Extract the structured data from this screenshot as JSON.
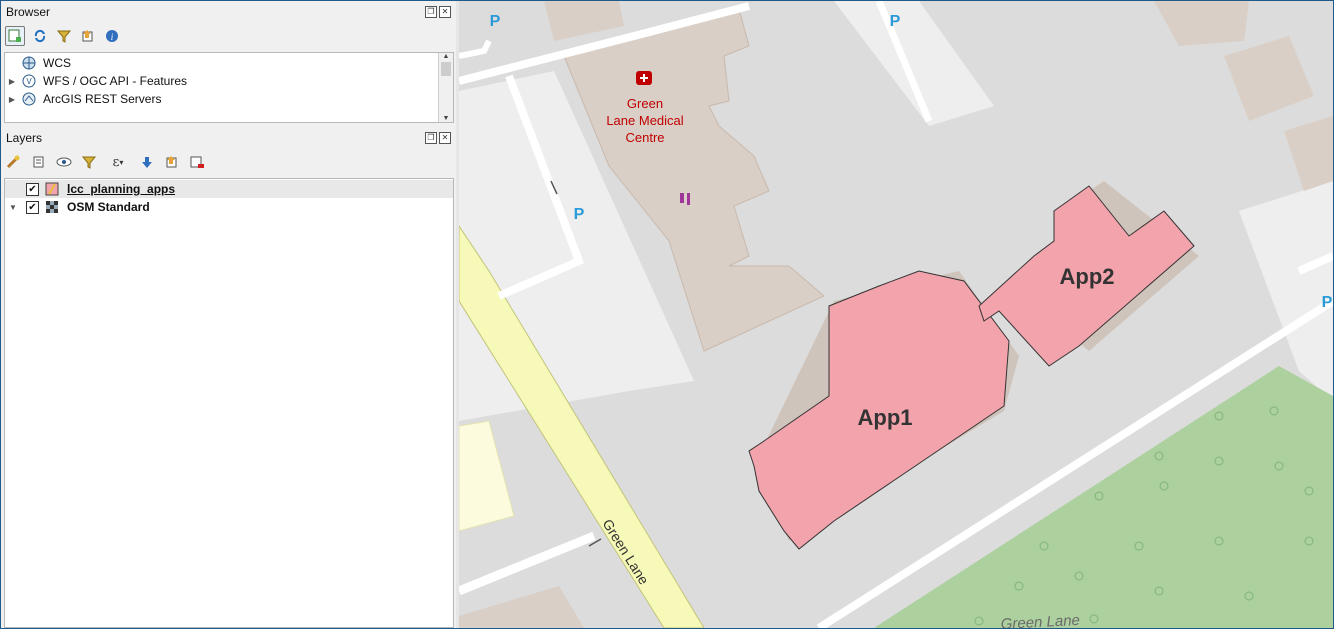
{
  "browser": {
    "title": "Browser",
    "items": [
      {
        "label": "WCS",
        "icon": "globe-icon"
      },
      {
        "label": "WFS / OGC API - Features",
        "icon": "wfs-globe-icon"
      },
      {
        "label": "ArcGIS REST Servers",
        "icon": "arcgis-globe-icon"
      }
    ]
  },
  "layers": {
    "title": "Layers",
    "items": [
      {
        "label": "lcc_planning_apps",
        "checked": true,
        "icon": "polygon-layer-icon"
      },
      {
        "label": "OSM Standard",
        "checked": true,
        "icon": "raster-layer-icon"
      }
    ]
  },
  "map": {
    "poi_label": "Green\nLane Medical\nCentre",
    "poi_lines": [
      "Green",
      "Lane Medical",
      "Centre"
    ],
    "parking_symbol": "P",
    "road_label": "Green Lane",
    "app1_label": "App1",
    "app2_label": "App2",
    "bottom_road_label": "Green Lane",
    "colors": {
      "background": "#dcdcdc",
      "building": "#d9cfc6",
      "parking_area": "#eeeeee",
      "road_yellow": "#f7f9b8",
      "park_green": "#add19e",
      "app_fill": "#f2a3ac",
      "poi_red": "#c00000",
      "parking_blue": "#2a9ad9"
    }
  }
}
